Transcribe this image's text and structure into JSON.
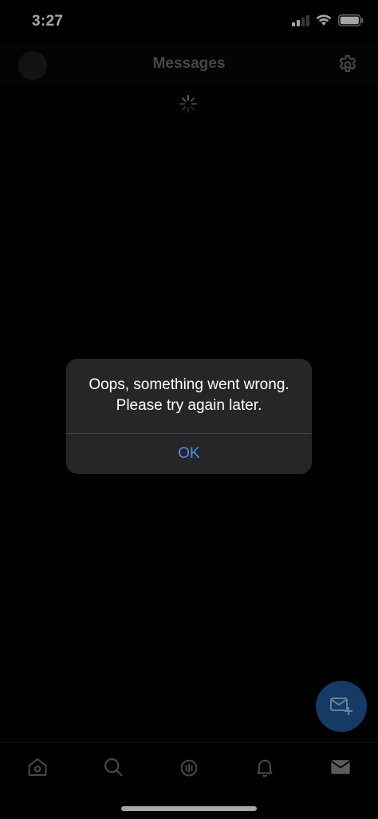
{
  "status_bar": {
    "time": "3:27"
  },
  "header": {
    "title": "Messages"
  },
  "alert": {
    "message": "Oops, something went wrong. Please try again later.",
    "ok_label": "OK"
  },
  "colors": {
    "accent": "#4c8ee6",
    "fab": "#1f5a9c",
    "alert_bg": "#262628"
  },
  "icons": {
    "settings": "gear-icon",
    "spinner": "loading-spinner-icon",
    "compose": "compose-message-icon",
    "tabs": [
      "home-icon",
      "search-icon",
      "spaces-icon",
      "notifications-icon",
      "messages-icon"
    ]
  }
}
